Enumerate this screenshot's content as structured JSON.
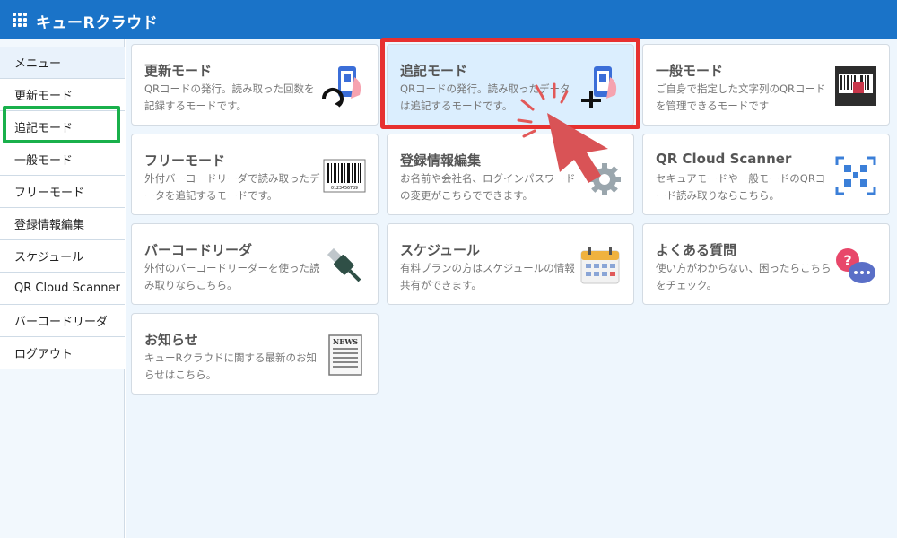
{
  "app": {
    "title": "キューRクラウド",
    "icon": "grid-icon",
    "brand_color": "#1a73c8"
  },
  "sidebar": {
    "items": [
      {
        "label": "メニュー"
      },
      {
        "label": "更新モード"
      },
      {
        "label": "追記モード"
      },
      {
        "label": "一般モード"
      },
      {
        "label": "フリーモード"
      },
      {
        "label": "登録情報編集"
      },
      {
        "label": "スケジュール"
      },
      {
        "label": "QR Cloud Scanner"
      },
      {
        "label": "バーコードリーダ"
      },
      {
        "label": "ログアウト"
      }
    ]
  },
  "cards": [
    {
      "title": "更新モード",
      "desc": "QRコードの発行。読み取った回数を記録するモードです。",
      "icon": "phone-refresh-icon"
    },
    {
      "title": "追記モード",
      "desc": "QRコードの発行。読み取ったデータは追記するモードです。",
      "icon": "phone-plus-icon"
    },
    {
      "title": "一般モード",
      "desc": "ご自身で指定した文字列のQRコードを管理できるモードです",
      "icon": "barcode-device-icon"
    },
    {
      "title": "フリーモード",
      "desc": "外付バーコードリーダで読み取ったデータを追記するモードです。",
      "icon": "barcode-icon",
      "barcode_number": "0123456789"
    },
    {
      "title": "登録情報編集",
      "desc": "お名前や会社名、ログインパスワードの変更がこちらでできます。",
      "icon": "gear-icon"
    },
    {
      "title": "QR Cloud Scanner",
      "desc": "セキュアモードや一般モードのQRコード読み取りならこちら。",
      "icon": "qr-scan-icon"
    },
    {
      "title": "バーコードリーダ",
      "desc": "外付のバーコードリーダーを使った読み取りならこちら。",
      "icon": "usb-icon"
    },
    {
      "title": "スケジュール",
      "desc": "有料プランの方はスケジュールの情報共有ができます。",
      "icon": "calendar-icon"
    },
    {
      "title": "よくある質問",
      "desc": "使い方がわからない、困ったらこちらをチェック。",
      "icon": "faq-chat-icon"
    },
    {
      "title": "お知らせ",
      "desc": "キューRクラウドに関する最新のお知らせはこちら。",
      "icon": "news-icon",
      "news_label": "NEWS"
    }
  ],
  "annotations": {
    "highlight_color": "#e7302f",
    "sidebar_highlight_color": "#19b04b",
    "pointer": "click-cursor-icon"
  }
}
